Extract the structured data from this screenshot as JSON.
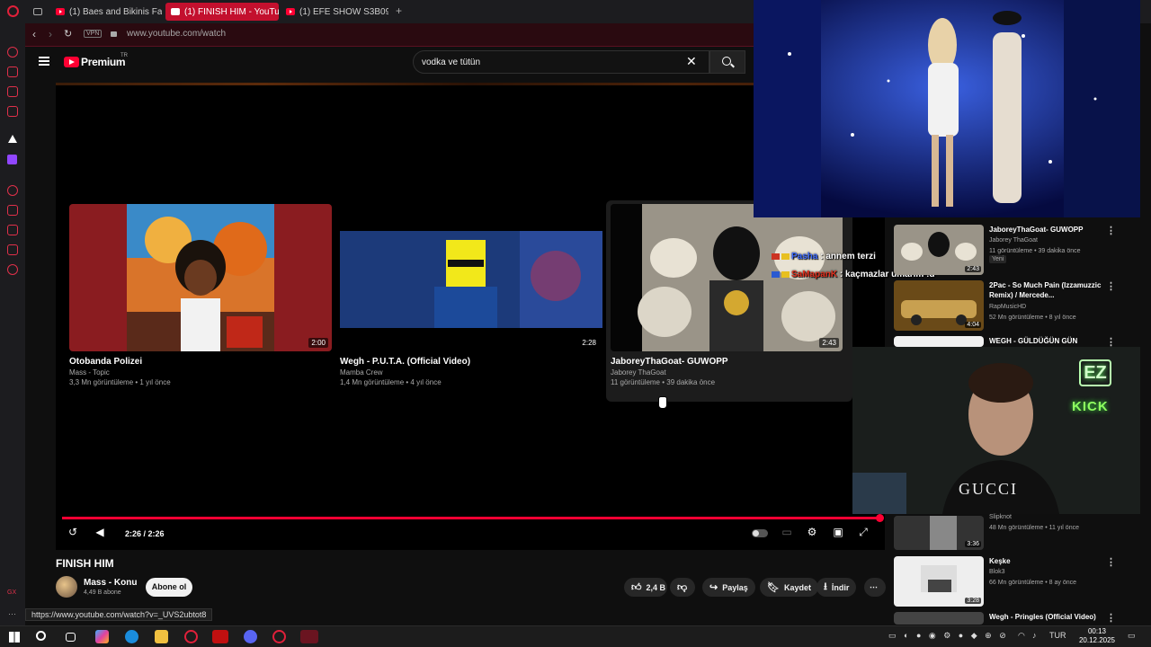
{
  "browser": {
    "tabs": [
      {
        "label": "(1) Baes and Bikinis Fashi"
      },
      {
        "label": "(1) FINISH HIM - YouTube"
      },
      {
        "label": "(1) EFE SHOW S3B09 | ŞA"
      }
    ],
    "new_tab": "+",
    "vpn_label": "VPN",
    "url": "www.youtube.com/watch"
  },
  "youtube": {
    "logo_text": "Premium",
    "logo_sup": "TR",
    "search_value": "vodka ve tütün"
  },
  "player": {
    "end_screen": [
      {
        "title": "Otobanda Polizei",
        "channel": "Mass - Topic",
        "meta": "3,3 Mn görüntüleme • 1 yıl önce",
        "duration": "2:00"
      },
      {
        "title": "Wegh - P.U.T.A. (Official Video)",
        "channel": "Mamba Crew",
        "meta": "1,4 Mn görüntüleme • 4 yıl önce",
        "duration": "2:28"
      },
      {
        "title": "JaboreyThaGoat- GUWOPP",
        "channel": "Jaborey ThaGoat",
        "meta": "11 görüntüleme • 39 dakika önce",
        "duration": "2:43"
      }
    ],
    "time": "2:26 / 2:26",
    "progress": 1.0
  },
  "video": {
    "title": "FINISH HIM",
    "channel": "Mass - Konu",
    "subscribers": "4,49 B abone",
    "subscribe_label": "Abone ol",
    "likes": "2,4 B",
    "share": "Paylaş",
    "save": "Kaydet",
    "download": "İndir"
  },
  "status_url": "https://www.youtube.com/watch?v=_UVS2ubtot8",
  "recommendations": [
    {
      "title": "JaboreyThaGoat- GUWOPP",
      "channel": "Jaborey ThaGoat",
      "meta": "11 görüntüleme • 39 dakika önce",
      "duration": "2:43",
      "badge": "Yeni"
    },
    {
      "title": "2Pac - So Much Pain (Izzamuzzic Remix) / Mercede...",
      "channel": "RapMusicHD",
      "meta": "52 Mn görüntüleme • 8 yıl önce",
      "duration": "4:04"
    },
    {
      "title": "WEGH - GÜLDÜĞÜN GÜN"
    },
    {
      "channel": "Slipknot",
      "meta": "48 Mn görüntüleme • 11 yıl önce",
      "duration": "3:36"
    },
    {
      "title": "Keşke",
      "channel": "Blok3",
      "meta": "66 Mn görüntüleme • 8 ay önce",
      "duration": "3:28"
    },
    {
      "title": "Wegh - Pringles (Official Video)"
    }
  ],
  "chat": [
    {
      "user": "Pasha",
      "message": ": annem terzi"
    },
    {
      "user": "SaMapanK",
      "message": ": kaçmazlar umarım :d"
    }
  ],
  "stream_overlay": {
    "top": "EZ",
    "bottom": "KICK",
    "shirt": "GUCCI"
  },
  "taskbar": {
    "language": "TUR",
    "time": "00:13",
    "date": "20.12.2025"
  }
}
